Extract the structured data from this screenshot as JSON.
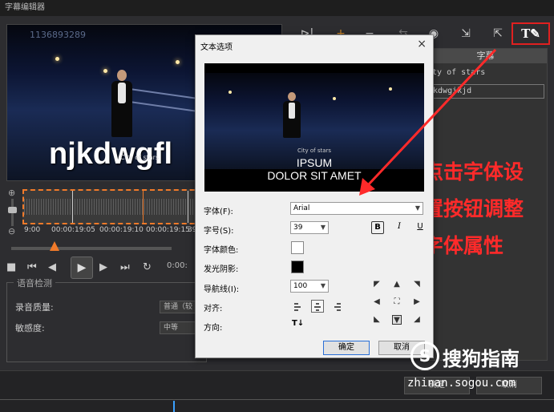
{
  "window": {
    "title": "字幕编辑器"
  },
  "preview": {
    "watermark": "1136893289",
    "subtitle": "njkdwgfl",
    "city": "City of stars"
  },
  "timeline": {
    "ticks": [
      "9:00",
      "00:00:19:05",
      "00:00:19:10",
      "00:00:19:15",
      "39"
    ]
  },
  "transport": {
    "timecode": "0:00:"
  },
  "voice_detect": {
    "title": "语音检测",
    "quality_label": "录音质量:",
    "quality_value": "普通（较",
    "sensitivity_label": "敏感度:",
    "sensitivity_value": "中等"
  },
  "subtitle_table": {
    "header": "字幕",
    "rows": [
      "ity of stars",
      "jkdwgikjd"
    ]
  },
  "annotation": {
    "lines": [
      "点击字体设",
      "置按钮调整",
      "字体属性"
    ]
  },
  "toolbar": {
    "font_settings_label": "T✎"
  },
  "dialog": {
    "title": "文本选项",
    "close": "×",
    "preview_city": "City of stars",
    "preview_line1": "IPSUM",
    "preview_line2": "DOLOR SIT AMET",
    "font_label": "字体(F):",
    "font_value": "Arial",
    "size_label": "字号(S):",
    "size_value": "39",
    "bold": "B",
    "italic": "I",
    "underline": "U",
    "color_label": "字体颜色:",
    "shadow_label": "发光阴影:",
    "guide_label": "导航线(I):",
    "guide_value": "100",
    "align_label": "对齐:",
    "direction_label": "方向:",
    "direction_icon": "T↓",
    "ok": "确定",
    "cancel": "取消"
  },
  "bottom_buttons": [
    "确定",
    "取消"
  ],
  "watermark": {
    "name": "搜狗指南",
    "url": "zhinan.sogou.com"
  }
}
